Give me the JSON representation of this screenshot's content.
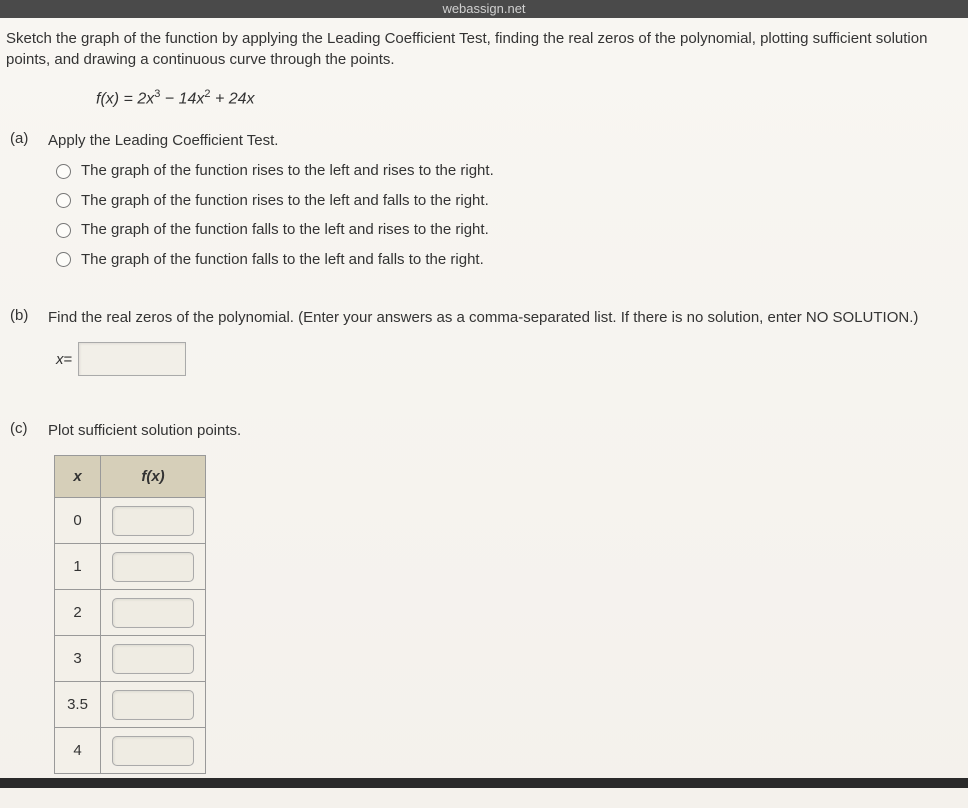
{
  "header": {
    "url": "webassign.net"
  },
  "intro": "Sketch the graph of the function by applying the Leading Coefficient Test, finding the real zeros of the polynomial, plotting sufficient solution points, and drawing a continuous curve through the points.",
  "formula": {
    "prefix": "f(x) = 2x",
    "exp1": "3",
    "mid1": " − 14x",
    "exp2": "2",
    "mid2": " + 24x"
  },
  "parts": {
    "a": {
      "label": "(a)",
      "question": "Apply the Leading Coefficient Test.",
      "options": [
        "The graph of the function rises to the left and rises to the right.",
        "The graph of the function rises to the left and falls to the right.",
        "The graph of the function falls to the left and rises to the right.",
        "The graph of the function falls to the left and falls to the right."
      ]
    },
    "b": {
      "label": "(b)",
      "question": "Find the real zeros of the polynomial. (Enter your answers as a comma-separated list. If there is no solution, enter NO SOLUTION.)",
      "var": "x",
      "equals": " = "
    },
    "c": {
      "label": "(c)",
      "question": "Plot sufficient solution points.",
      "headers": {
        "x": "x",
        "fx": "f(x)"
      },
      "rows": [
        "0",
        "1",
        "2",
        "3",
        "3.5",
        "4"
      ]
    }
  }
}
